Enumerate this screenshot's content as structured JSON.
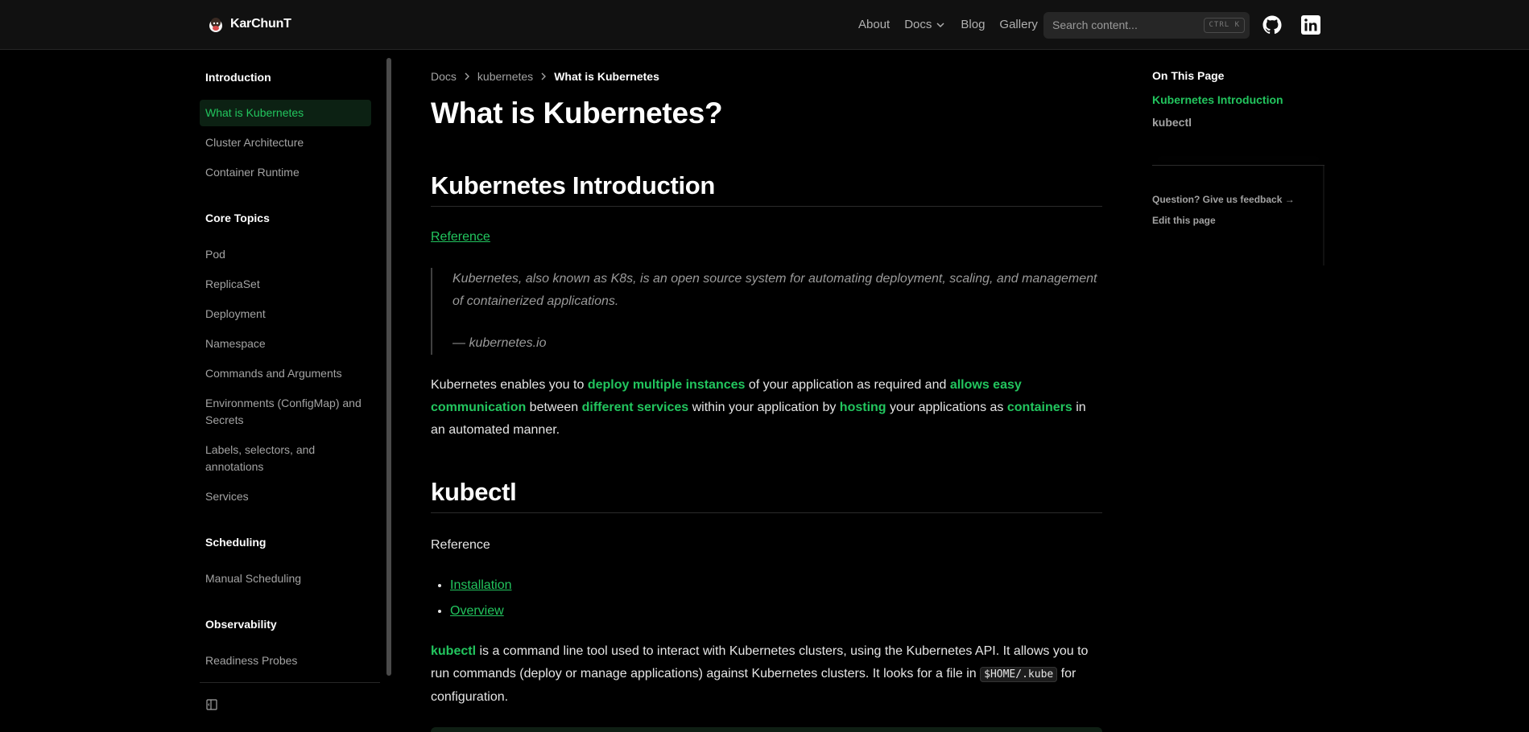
{
  "navbar": {
    "brand": "KarChunT",
    "links": [
      "About",
      "Docs",
      "Blog",
      "Gallery"
    ],
    "search_placeholder": "Search content...",
    "search_shortcut": "CTRL K",
    "icons": [
      "github-icon",
      "linkedin-icon"
    ]
  },
  "sidebar": {
    "items": [
      {
        "label": "Introduction",
        "type": "heading"
      },
      {
        "label": "What is Kubernetes",
        "type": "active"
      },
      {
        "label": "Cluster Architecture",
        "type": "link"
      },
      {
        "label": "Container Runtime",
        "type": "link"
      },
      {
        "label": "Core Topics",
        "type": "heading"
      },
      {
        "label": "Pod",
        "type": "link"
      },
      {
        "label": "ReplicaSet",
        "type": "link"
      },
      {
        "label": "Deployment",
        "type": "link"
      },
      {
        "label": "Namespace",
        "type": "link"
      },
      {
        "label": "Commands and Arguments",
        "type": "link"
      },
      {
        "label": "Environments (ConfigMap) and Secrets",
        "type": "link"
      },
      {
        "label": "Labels, selectors, and annotations",
        "type": "link"
      },
      {
        "label": "Services",
        "type": "link"
      },
      {
        "label": "Scheduling",
        "type": "heading"
      },
      {
        "label": "Manual Scheduling",
        "type": "link"
      },
      {
        "label": "Observability",
        "type": "heading"
      },
      {
        "label": "Readiness Probes",
        "type": "link"
      }
    ]
  },
  "breadcrumb": [
    "Docs",
    "kubernetes",
    "What is Kubernetes"
  ],
  "page": {
    "title": "What is Kubernetes?",
    "section1": {
      "heading": "Kubernetes Introduction",
      "reference_link": "Reference",
      "quote": "Kubernetes, also known as K8s, is an open source system for automating deployment, scaling, and management of containerized applications.",
      "quote_source": "— kubernetes.io",
      "p_parts": [
        "Kubernetes enables you to ",
        "deploy multiple instances",
        " of your application as required and ",
        "allows easy communication",
        " between ",
        "different services",
        " within your application by ",
        "hosting",
        " your applications as ",
        "containers",
        " in an automated manner."
      ]
    },
    "section2": {
      "heading": "kubectl",
      "reference_text": "Reference",
      "links": [
        "Installation",
        "Overview"
      ],
      "p_parts": [
        "kubectl",
        " is a command line tool used to interact with Kubernetes clusters, using the Kubernetes API. It allows you to run commands (deploy or manage applications) against Kubernetes clusters. It looks for a file in ",
        "$HOME/.kube",
        " for configuration."
      ]
    }
  },
  "toc": {
    "title": "On This Page",
    "links": [
      "Kubernetes Introduction",
      "kubectl"
    ],
    "feedback": "Question? Give us feedback →",
    "edit": "Edit this page"
  },
  "colors": {
    "accent": "#22c55e",
    "background": "#000000",
    "navbar": "#111111"
  }
}
